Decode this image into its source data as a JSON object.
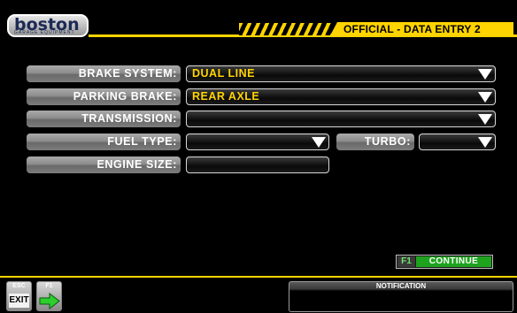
{
  "header": {
    "logo_text": "boston",
    "logo_sub": "GARAGE EQUIPMENT",
    "title": "OFFICIAL - DATA ENTRY 2"
  },
  "form": {
    "brake_system": {
      "label": "BRAKE SYSTEM:",
      "value": "DUAL LINE"
    },
    "parking_brake": {
      "label": "PARKING BRAKE:",
      "value": "REAR AXLE"
    },
    "transmission": {
      "label": "TRANSMISSION:",
      "value": ""
    },
    "fuel_type": {
      "label": "FUEL TYPE:",
      "value": ""
    },
    "turbo": {
      "label": "TURBO:",
      "value": ""
    },
    "engine_size": {
      "label": "ENGINE SIZE:",
      "value": ""
    }
  },
  "continue": {
    "key": "F1",
    "label": "CONTINUE"
  },
  "footer": {
    "esc_key": "ESC",
    "exit_label": "EXIT",
    "f1_key": "F1",
    "notification_title": "NOTIFICATION",
    "notification_text": ""
  },
  "colors": {
    "accent": "#ffd400",
    "continue": "#1fa31f",
    "arrow_icon": "#2dcf2d"
  },
  "icons": [
    "dropdown-arrow-icon",
    "right-arrow-icon"
  ]
}
